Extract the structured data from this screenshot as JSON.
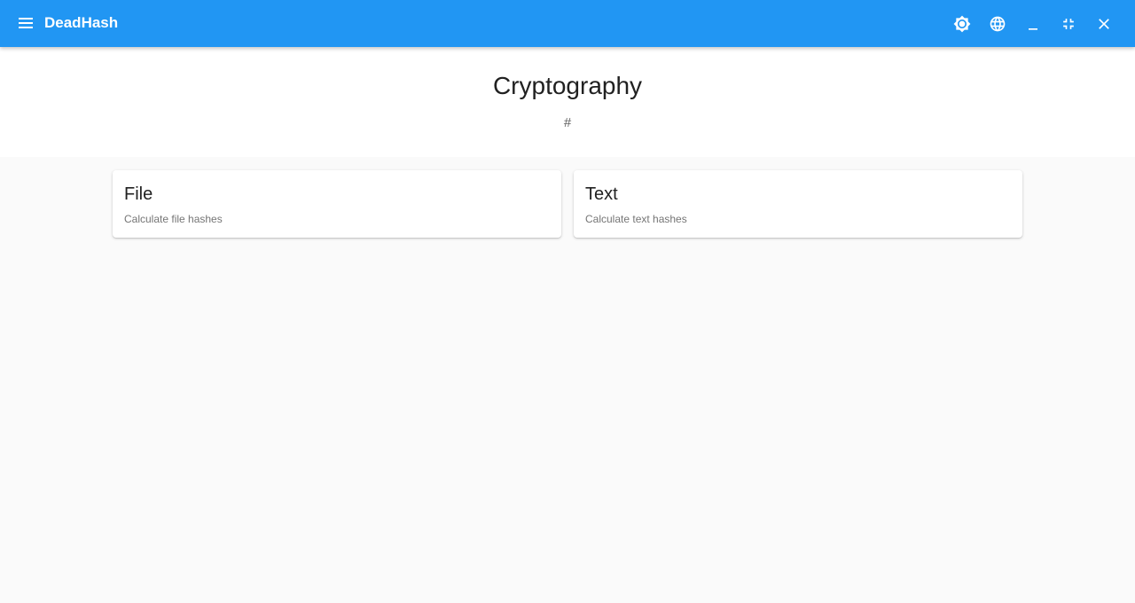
{
  "appbar": {
    "title": "DeadHash",
    "color": "#2196f3",
    "menu_icon": "menu-icon",
    "actions": [
      {
        "name": "theme-toggle-button",
        "icon": "brightness-icon"
      },
      {
        "name": "language-button",
        "icon": "globe-icon"
      },
      {
        "name": "minimize-button",
        "icon": "minimize-icon"
      },
      {
        "name": "fullscreen-exit-button",
        "icon": "fullscreen-exit-icon"
      },
      {
        "name": "close-button",
        "icon": "close-icon"
      }
    ]
  },
  "header": {
    "title": "Cryptography",
    "subtitle": "#"
  },
  "cards": [
    {
      "title": "File",
      "description": "Calculate file hashes"
    },
    {
      "title": "Text",
      "description": "Calculate text hashes"
    }
  ]
}
